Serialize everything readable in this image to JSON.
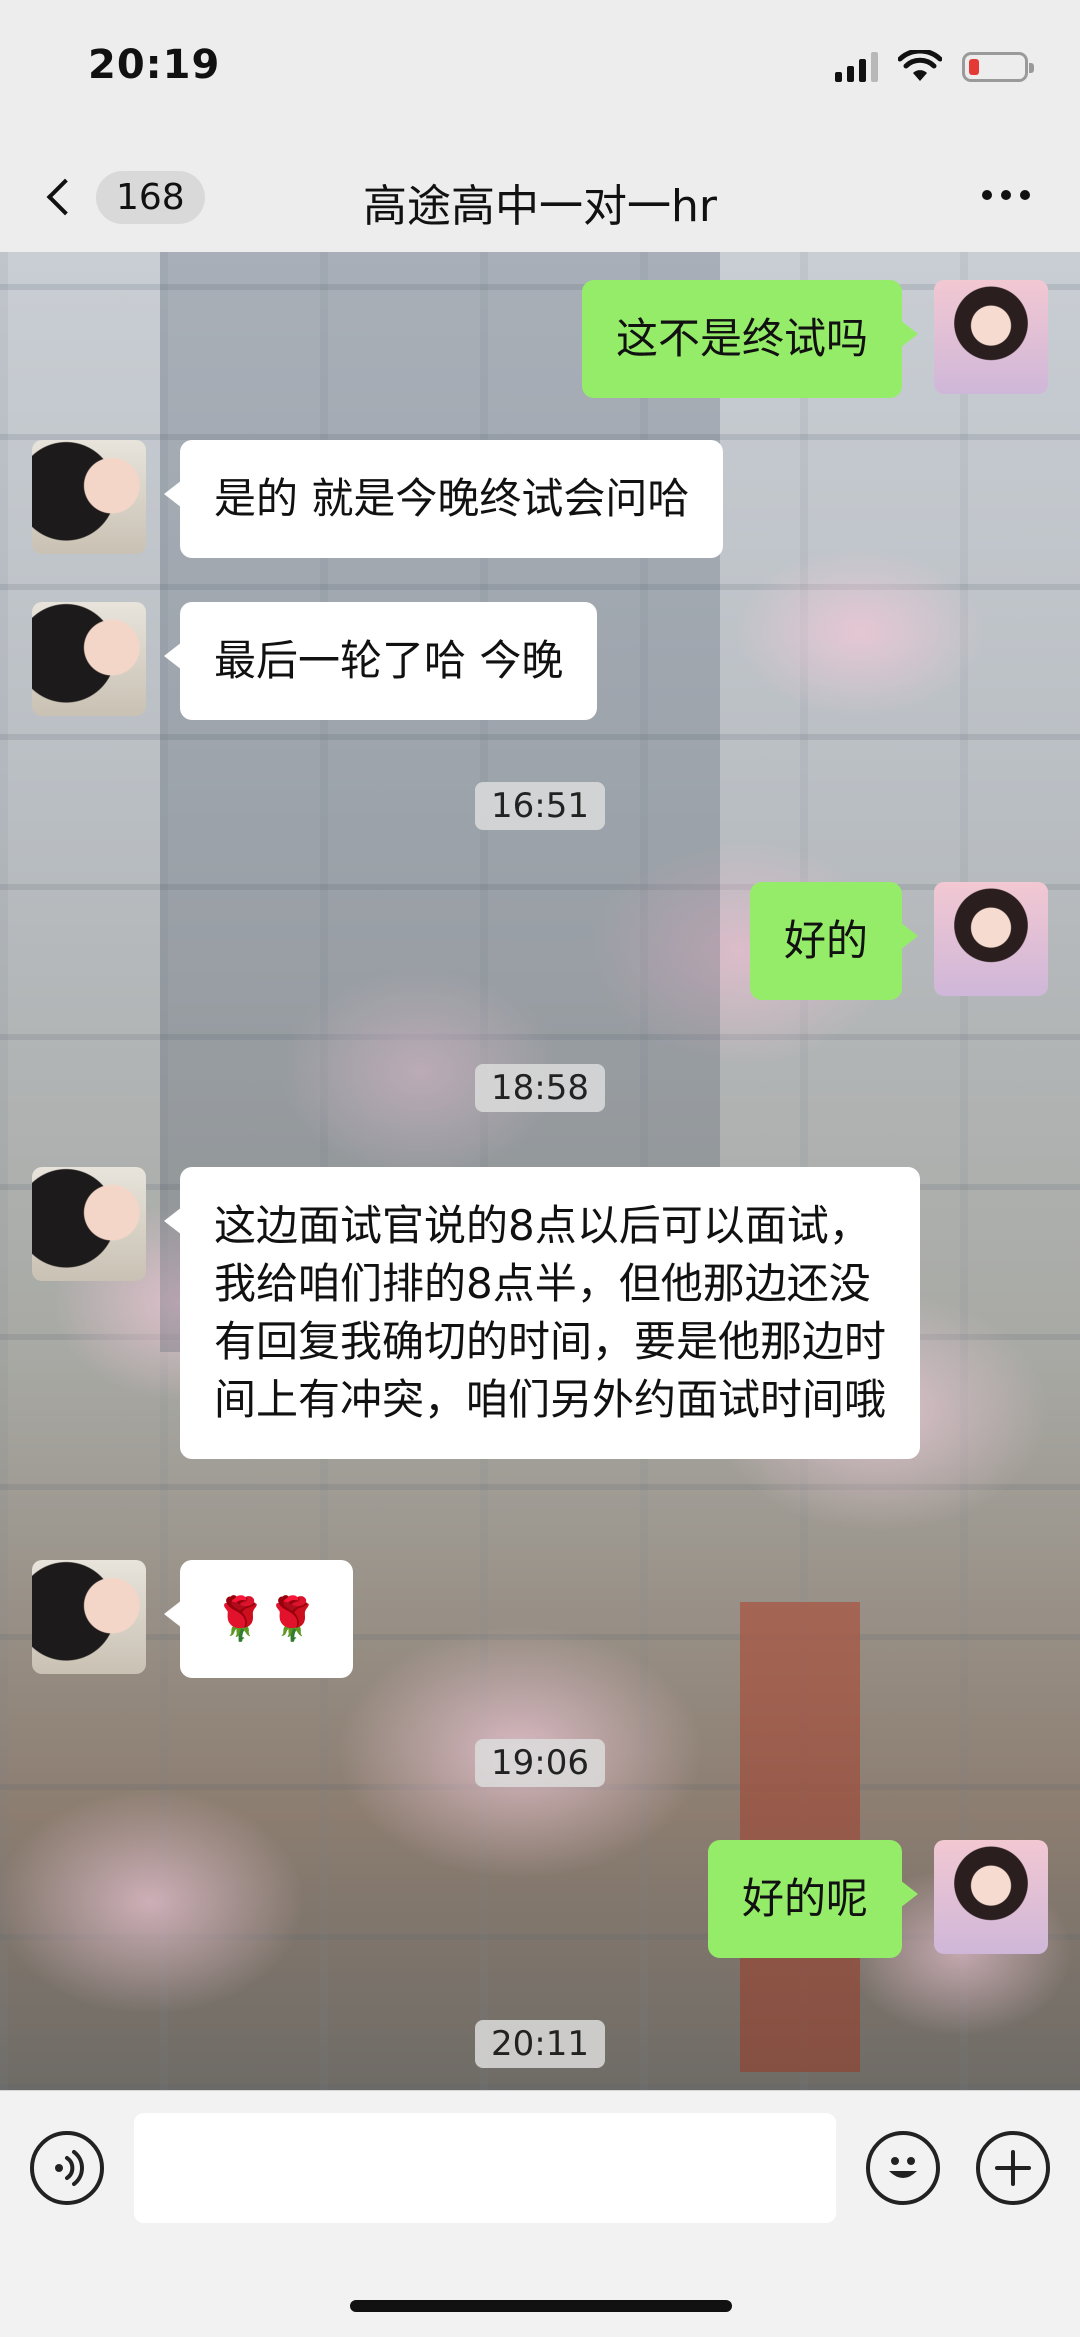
{
  "status_bar": {
    "time": "20:19"
  },
  "nav": {
    "unread_count": "168",
    "title": "高途高中一对一hr"
  },
  "messages": [
    {
      "side": "out",
      "text": "这不是终试吗"
    },
    {
      "side": "in",
      "text": "是的 就是今晚终试会问哈"
    },
    {
      "side": "in",
      "text": "最后一轮了哈 今晚"
    },
    {
      "side": "time",
      "text": "16:51"
    },
    {
      "side": "out",
      "text": "好的"
    },
    {
      "side": "time",
      "text": "18:58"
    },
    {
      "side": "in",
      "text": "这边面试官说的8点以后可以面试，我给咱们排的8点半，但他那边还没有回复我确切的时间，要是他那边时间上有冲突，咱们另外约面试时间哦"
    },
    {
      "side": "in",
      "text": "🌹🌹"
    },
    {
      "side": "time",
      "text": "19:06"
    },
    {
      "side": "out",
      "text": "好的呢"
    },
    {
      "side": "time",
      "text": "20:11"
    }
  ],
  "input": {
    "placeholder": ""
  },
  "icons": {
    "back": "chevron-left-icon",
    "more": "more-dots-icon",
    "voice": "voice-icon",
    "emoji": "emoji-icon",
    "plus": "plus-icon"
  },
  "colors": {
    "outgoing_bubble": "#95ec69",
    "incoming_bubble": "#ffffff",
    "battery_low": "#e53935"
  }
}
